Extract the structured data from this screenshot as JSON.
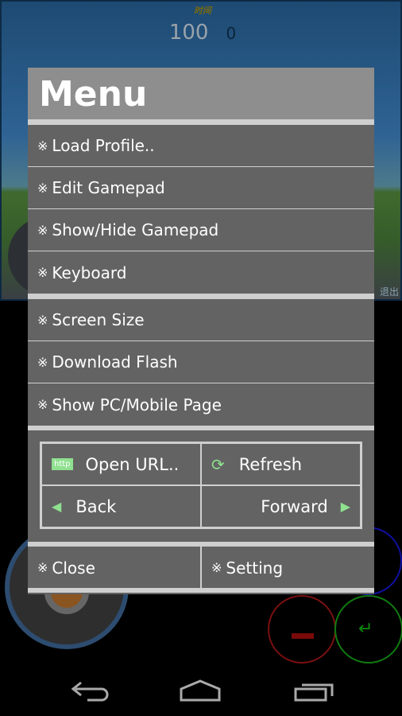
{
  "game": {
    "timer": "时间",
    "score": "100",
    "score2": "0",
    "exit": "退出"
  },
  "menu": {
    "title": "Menu",
    "bullet": "※",
    "group1": [
      "Load Profile..",
      "Edit Gamepad",
      "Show/Hide Gamepad",
      "Keyboard"
    ],
    "group2": [
      "Screen Size",
      "Download Flash",
      "Show PC/Mobile Page"
    ],
    "grid": {
      "open_url": "Open URL..",
      "http_badge": "http",
      "refresh": "Refresh",
      "back": "Back",
      "forward": "Forward"
    },
    "close": "Close",
    "setting": "Setting"
  },
  "colors": {
    "accent": "#8fe08f",
    "panel": "#636363",
    "title_bg": "#8e8e8e"
  }
}
